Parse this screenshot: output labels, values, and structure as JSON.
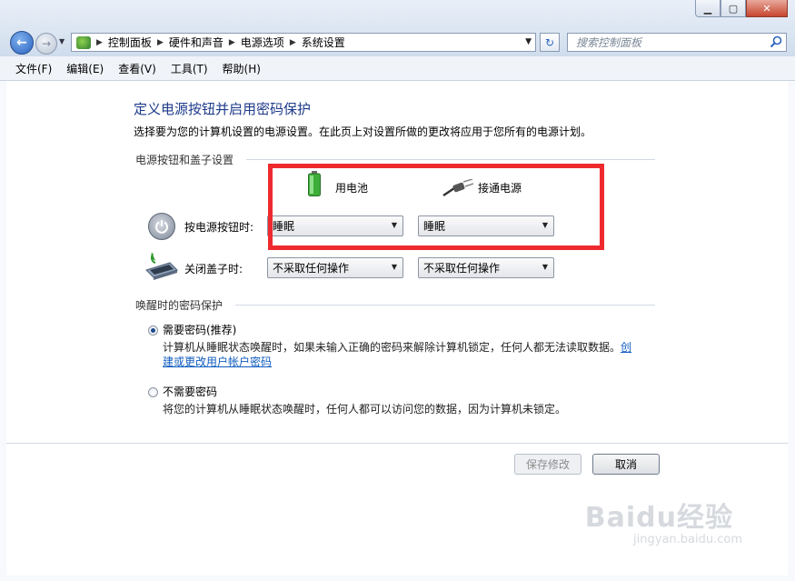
{
  "window": {
    "minimize": "▁",
    "maximize": "▢",
    "close": "✕"
  },
  "nav": {
    "breadcrumbs": [
      "控制面板",
      "硬件和声音",
      "电源选项",
      "系统设置"
    ],
    "search_placeholder": "搜索控制面板"
  },
  "menu": [
    "文件(F)",
    "编辑(E)",
    "查看(V)",
    "工具(T)",
    "帮助(H)"
  ],
  "page": {
    "title": "定义电源按钮并启用密码保护",
    "description": "选择要为您的计算机设置的电源设置。在此页上对设置所做的更改将应用于您所有的电源计划。"
  },
  "power_section": {
    "header": "电源按钮和盖子设置",
    "columns": {
      "battery": "用电池",
      "plugged": "接通电源"
    },
    "rows": [
      {
        "label": "按电源按钮时:",
        "battery": "睡眠",
        "plugged": "睡眠"
      },
      {
        "label": "关闭盖子时:",
        "battery": "不采取任何操作",
        "plugged": "不采取任何操作"
      }
    ]
  },
  "password_section": {
    "header": "唤醒时的密码保护",
    "options": [
      {
        "label": "需要密码(推荐)",
        "checked": true,
        "desc": "计算机从睡眠状态唤醒时，如果未输入正确的密码来解除计算机锁定，任何人都无法读取数据。",
        "link_part1": "创",
        "link_part2": "建或更改用户帐户密码"
      },
      {
        "label": "不需要密码",
        "checked": false,
        "desc": "将您的计算机从睡眠状态唤醒时，任何人都可以访问您的数据，因为计算机未锁定。"
      }
    ]
  },
  "buttons": {
    "save": "保存修改",
    "cancel": "取消"
  },
  "watermark": {
    "brand": "Baidu经验",
    "url": "jingyan.baidu.com"
  },
  "colors": {
    "highlight_box": "#ef2a2f",
    "title": "#1e3a8a",
    "link": "#0f5cbf"
  }
}
